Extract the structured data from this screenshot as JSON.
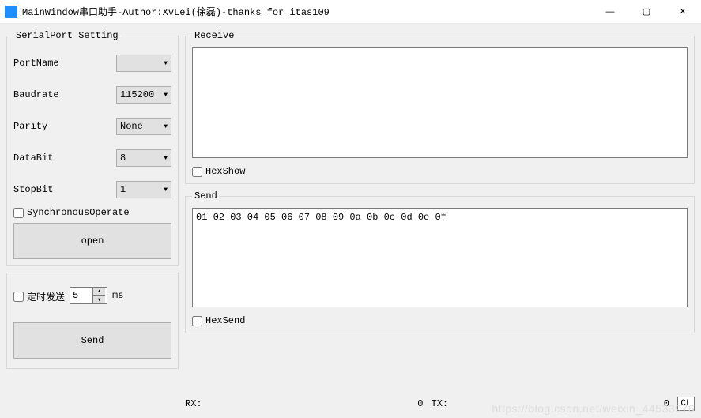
{
  "window": {
    "title": "MainWindow串口助手-Author:XvLei(徐磊)-thanks for itas109"
  },
  "serial": {
    "legend": "SerialPort Setting",
    "portname_label": "PortName",
    "portname_value": "",
    "baudrate_label": "Baudrate",
    "baudrate_value": "115200",
    "parity_label": "Parity",
    "parity_value": "None",
    "databit_label": "DataBit",
    "databit_value": "8",
    "stopbit_label": "StopBit",
    "stopbit_value": "1",
    "sync_label": "SynchronousOperate",
    "open_label": "open"
  },
  "timer": {
    "label": "定时发送",
    "value": "5",
    "unit": "ms",
    "send_label": "Send"
  },
  "receive": {
    "legend": "Receive",
    "text": "",
    "hexshow_label": "HexShow"
  },
  "send": {
    "legend": "Send",
    "text": "01 02 03 04 05 06 07 08 09 0a 0b 0c 0d 0e 0f",
    "hexsend_label": "HexSend"
  },
  "status": {
    "rx_label": "RX:",
    "rx_count": "0",
    "tx_label": "TX:",
    "tx_count": "0",
    "clear_label": "CL"
  },
  "watermark": "https://blog.csdn.net/weixin_44533976"
}
